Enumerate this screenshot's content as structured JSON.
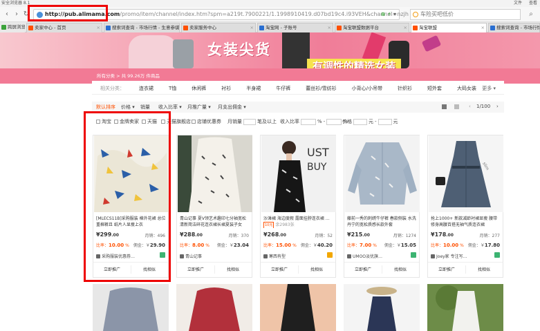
{
  "browser": {
    "window_title": "安全浏览器 8.1",
    "menu_file": "文件",
    "menu_view": "查看",
    "url_domain": "http://pub.alimama.com",
    "url_path": "/promo/item/channel/index.htm?spm=a219t.7900221/1.1998910419.d07bd19c4.i93VEH&channel=nzjh",
    "search_placeholder": "车险买吧低价",
    "tabs": [
      {
        "label": "跨屏浏览",
        "icon": "green"
      },
      {
        "label": "卖家中心 - 首页",
        "icon": "orange"
      },
      {
        "label": "搜索词查询 - 市场行情 - 生意参谋",
        "icon": "blue"
      },
      {
        "label": "卖家服务中心",
        "icon": "orange"
      },
      {
        "label": "淘宝网 - 子账号",
        "icon": "blue"
      },
      {
        "label": "淘宝联盟数据平台",
        "icon": "orange"
      },
      {
        "label": "淘宝联盟",
        "icon": "orange"
      },
      {
        "label": "搜索词查询 - 市场行情",
        "icon": "blue"
      }
    ]
  },
  "banner": {
    "title": "女装尖货",
    "slogan": "有调性的精选女装"
  },
  "subbar": {
    "text": "所有分类 > 共 99.26万 件商品"
  },
  "category_nav": {
    "label": "相关分类：",
    "items": [
      "连衣裙",
      "T恤",
      "休闲裤",
      "衬衫",
      "半身裙",
      "牛仔裤",
      "蕾丝衫/雪纺衫",
      "小背心/小吊带",
      "针织衫",
      "短外套",
      "大码女装"
    ],
    "more": "更多"
  },
  "sort_bar": {
    "items": [
      "默认排序",
      "价格",
      "销量",
      "收入比率",
      "月推广量",
      "月支出佣金"
    ],
    "pager": "1/100"
  },
  "filter_bar": {
    "checks": [
      "淘宝",
      "金牌卖家",
      "天猫",
      "天猫旗舰店",
      "店铺优惠券"
    ],
    "sales_label": "月销量",
    "sales_suffix": "笔及以上",
    "ratio_label": "收入比率",
    "ratio_unit": "%",
    "price_label": "价格",
    "price_unit": "元"
  },
  "products": [
    {
      "title": "[MLECS11B]采购服装 棉外花裙 总位重棉裤且 纸片人显瘦上衣",
      "price": "¥299",
      "price_dec": ".00",
      "sales": "月销：496",
      "ratio": "10.00",
      "comm": "29.90",
      "shop": "采购服装优惠券…",
      "badge": "taobao",
      "promote": "立即推广",
      "similar": "找相似"
    },
    {
      "title": "青山记事 夏V领艺术趣印七分袖宽松 清新简洁碎花连衣裙长裙夏装子女",
      "price": "¥288",
      "price_dec": ".00",
      "sales": "月销：370",
      "ratio": "8.00",
      "comm": "23.04",
      "shop": "青山记事",
      "badge": "",
      "promote": "立即推广",
      "similar": "找相似"
    },
    {
      "title": "沙滩裙 海边度假 露面挂脖连衣裙 …",
      "price": "¥268",
      "price_dec": ".00",
      "sales": "月销：52",
      "ratio": "15.00",
      "comm": "40.20",
      "shop": "寒西有型",
      "badge": "tmall",
      "coupon": "10元",
      "coupon_left": "余2983张",
      "promote": "立即推广",
      "similar": "找相似"
    },
    {
      "title": "藤前一秀的刺绣牛仔裤 春款侧装 水洗丹宁的宽松质感长款外套",
      "price": "¥215",
      "price_dec": ".00",
      "sales": "月销：1274",
      "ratio": "7.00",
      "comm": "15.05",
      "shop": "UMOO淡优旗…",
      "badge": "taobao",
      "promote": "立即推广",
      "similar": "找相似"
    },
    {
      "title": "抢上1000+ 新款减龄衬裙显瘦 腰带修身高腰百搭无袖气质连衣裙",
      "price": "¥178",
      "price_dec": ".00",
      "sales": "月销：277",
      "ratio": "10.00",
      "comm": "17.80",
      "shop": "Joey家 专注写…",
      "badge": "taobao",
      "promote": "立即推广",
      "similar": "找相似"
    }
  ],
  "labels": {
    "ratio": "比率：",
    "comm": "佣金：￥"
  },
  "colors": {
    "accent": "#ff5000",
    "banner_pink": "#f07d98",
    "highlight_red": "#ee0000"
  }
}
